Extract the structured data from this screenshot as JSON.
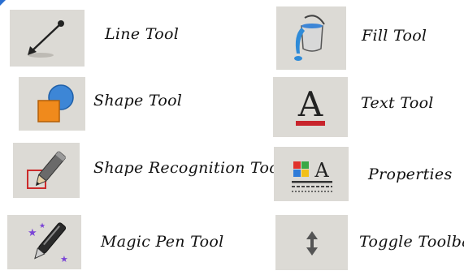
{
  "tools_left": [
    {
      "label": "Line Tool",
      "icon": "line-tool-icon"
    },
    {
      "label": "Shape Tool",
      "icon": "shape-tool-icon"
    },
    {
      "label": "Shape Recognition Tool",
      "icon": "shape-recognition-tool-icon"
    },
    {
      "label": "Magic Pen Tool",
      "icon": "magic-pen-tool-icon"
    }
  ],
  "tools_right": [
    {
      "label": "Fill Tool",
      "icon": "fill-tool-icon"
    },
    {
      "label": "Text Tool",
      "icon": "text-tool-icon"
    },
    {
      "label": "Properties",
      "icon": "properties-icon"
    },
    {
      "label": "Toggle Toolbar",
      "icon": "toggle-toolbar-icon"
    }
  ],
  "icon_glyphs": {
    "text_tool": "A",
    "properties": "A"
  },
  "colors": {
    "tile_background": "#dcdad5",
    "shape_square": "#f08a1c",
    "shape_circle": "#3d86d6",
    "text_underline": "#c8242c",
    "recognition_box": "#cc2b2b",
    "accent": "#2a6fd1"
  }
}
